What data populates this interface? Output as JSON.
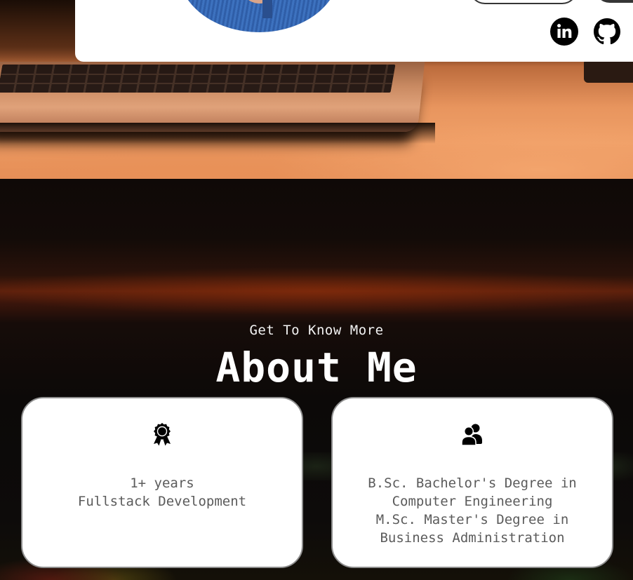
{
  "about": {
    "eyebrow": "Get To Know More",
    "title": "About Me"
  },
  "cards": {
    "experience": {
      "icon": "award-medal-icon",
      "line1": "1+ years",
      "line2": "Fullstack Development"
    },
    "education": {
      "icon": "users-icon",
      "line1": "B.Sc. Bachelor's Degree in",
      "line2": "Computer Engineering",
      "line3": "M.Sc. Master's Degree in",
      "line4": "Business Administration"
    }
  },
  "social": {
    "linkedin_icon": "linkedin-icon",
    "github_icon": "github-icon"
  },
  "colors": {
    "card_background": "#ffffff",
    "card_border": "#8e8e8e",
    "card_text": "#5b5b5b",
    "heading_text": "#ffffff",
    "button_dark": "#353535"
  }
}
